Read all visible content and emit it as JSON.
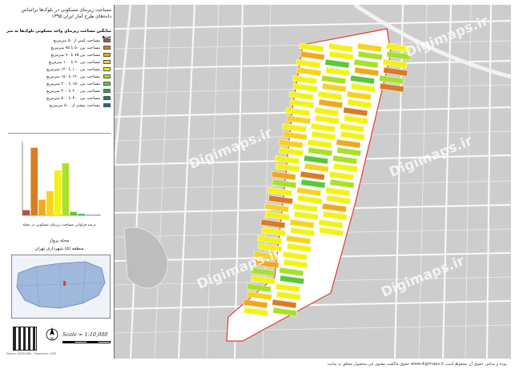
{
  "panel": {
    "title": "مساحت زیربنای مسکونی در بلوک‌ها براساس داده‌های طرح آمار ایران ۱۳۹۵",
    "legend_heading": "میانگین مساحت زیربنای واحد مسکونی بلوک‌ها به متر مربع",
    "legend": [
      {
        "label": "مساحت کمتر از ۵۰ مترمربع",
        "color": "#b5523b"
      },
      {
        "label": "مساحت بین ۵۰ تا ۷۵ مترمربع",
        "color": "#d97c22"
      },
      {
        "label": "مساحت بین ۷۵ تا ۹۰ مترمربع",
        "color": "#f2a81c"
      },
      {
        "label": "مساحت بین ۹۰ تا ۱۰۰ مترمربع",
        "color": "#f8d21c"
      },
      {
        "label": "مساحت بین ۱۰۰ تا ۱۲۰ مترمربع",
        "color": "#f4f213"
      },
      {
        "label": "مساحت بین ۱۲۰ تا ۱۵۰ مترمربع",
        "color": "#a9e02a"
      },
      {
        "label": "مساحت بین ۱۵۰ تا ۲۰۰ مترمربع",
        "color": "#59c93a"
      },
      {
        "label": "مساحت بین ۲۰۰ تا ۳۰۰ مترمربع",
        "color": "#2ea64a"
      },
      {
        "label": "مساحت بین ۳۰۰ تا ۵۰۰ مترمربع",
        "color": "#2a7a5c"
      },
      {
        "label": "مساحت بیشتر از ۵۰۰ مترمربع",
        "color": "#1f6a8f"
      }
    ],
    "histogram_caption": "درصد فراوانی مساحت زیربنای مسکونی در محله",
    "location_title": "محله پرواز",
    "location_subtitle": "منطقه (۵) شهرداری تهران",
    "scale_label": "Scale = 1:10,000",
    "north_label": "N",
    "panel_footer": "Datum: WGS1984 · Projection: UTM"
  },
  "chart_data": {
    "type": "bar",
    "categories": [
      "<50",
      "50-75",
      "75-90",
      "90-100",
      "100-120",
      "120-150",
      "150-200",
      "200-300",
      "300-500",
      ">500"
    ],
    "values": [
      6,
      78,
      18,
      28,
      52,
      60,
      4,
      1.5,
      0.5,
      0.5
    ],
    "colors": [
      "#b5523b",
      "#d97c22",
      "#f2a81c",
      "#f8d21c",
      "#f4f213",
      "#a9e02a",
      "#59c93a",
      "#2ea64a",
      "#2a7a5c",
      "#1f6a8f"
    ],
    "ylim": [
      0,
      85
    ]
  },
  "map": {
    "watermark": "Digimaps.ir"
  },
  "footer": "حقوق مالکیت معنوی این محصول متعلق به سایت www.digimaps.ir بوده و تمامی حقوق آن محفوظ است."
}
